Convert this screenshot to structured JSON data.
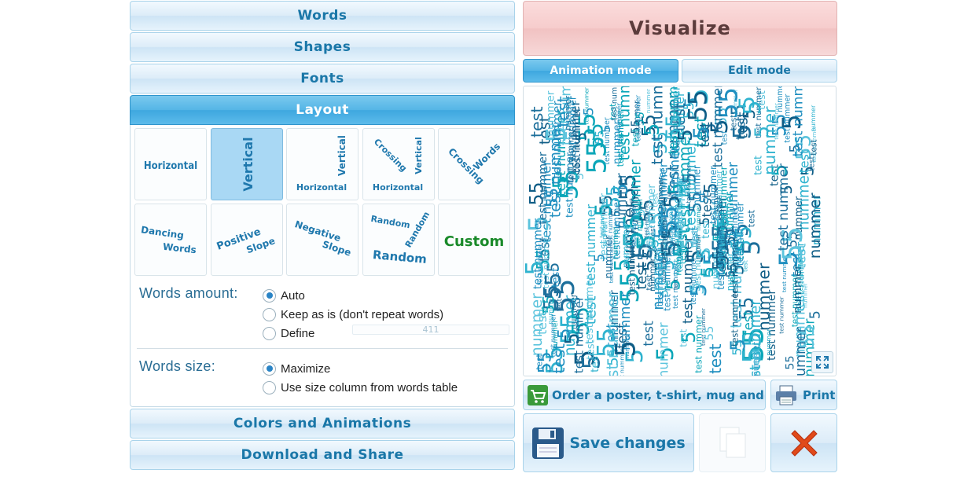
{
  "accordion": {
    "words": "Words",
    "shapes": "Shapes",
    "fonts": "Fonts",
    "layout": "Layout",
    "colors": "Colors and Animations",
    "download": "Download and Share"
  },
  "layouts": {
    "horizontal": "Horizontal",
    "vertical": "Vertical",
    "vh_vertical": "Vertical",
    "vh_horizontal": "Horizontal",
    "cvh_crossing": "Crossing",
    "cvh_vertical": "Vertical",
    "cvh_horizontal": "Horizontal",
    "cw_crossing": "Crossing",
    "cw_words": "Words",
    "dancing": "Dancing",
    "dancing_words": "Words",
    "positive": "Positive",
    "positive_slope": "Slope",
    "negative": "Negative",
    "negative_slope": "Slope",
    "random1": "Random",
    "random2": "Random",
    "random3": "Random",
    "custom": "Custom"
  },
  "words_amount": {
    "label": "Words amount:",
    "options": [
      "Auto",
      "Keep as is (don't repeat words)",
      "Define"
    ],
    "define_value": "411"
  },
  "words_size": {
    "label": "Words size:",
    "options": [
      "Maximize",
      "Use size column from words table"
    ]
  },
  "right": {
    "visualize": "Visualize",
    "animation_mode": "Animation mode",
    "edit_mode": "Edit mode",
    "order": "Order a poster, t-shirt, mug and more",
    "print": "Print",
    "save": "Save changes"
  },
  "cloud": {
    "words": [
      "test nummer",
      "5",
      "55",
      "test",
      "nummer"
    ],
    "colors": [
      "#0f5d86",
      "#1f8fc0",
      "#2fb3cf",
      "#0aa6b8",
      "#5cc4dd",
      "#1d6f9b"
    ]
  },
  "colors": {
    "accent": "#3ea7df",
    "visualize_bg": "#f6cccc",
    "custom_green": "#1a8a2a"
  }
}
